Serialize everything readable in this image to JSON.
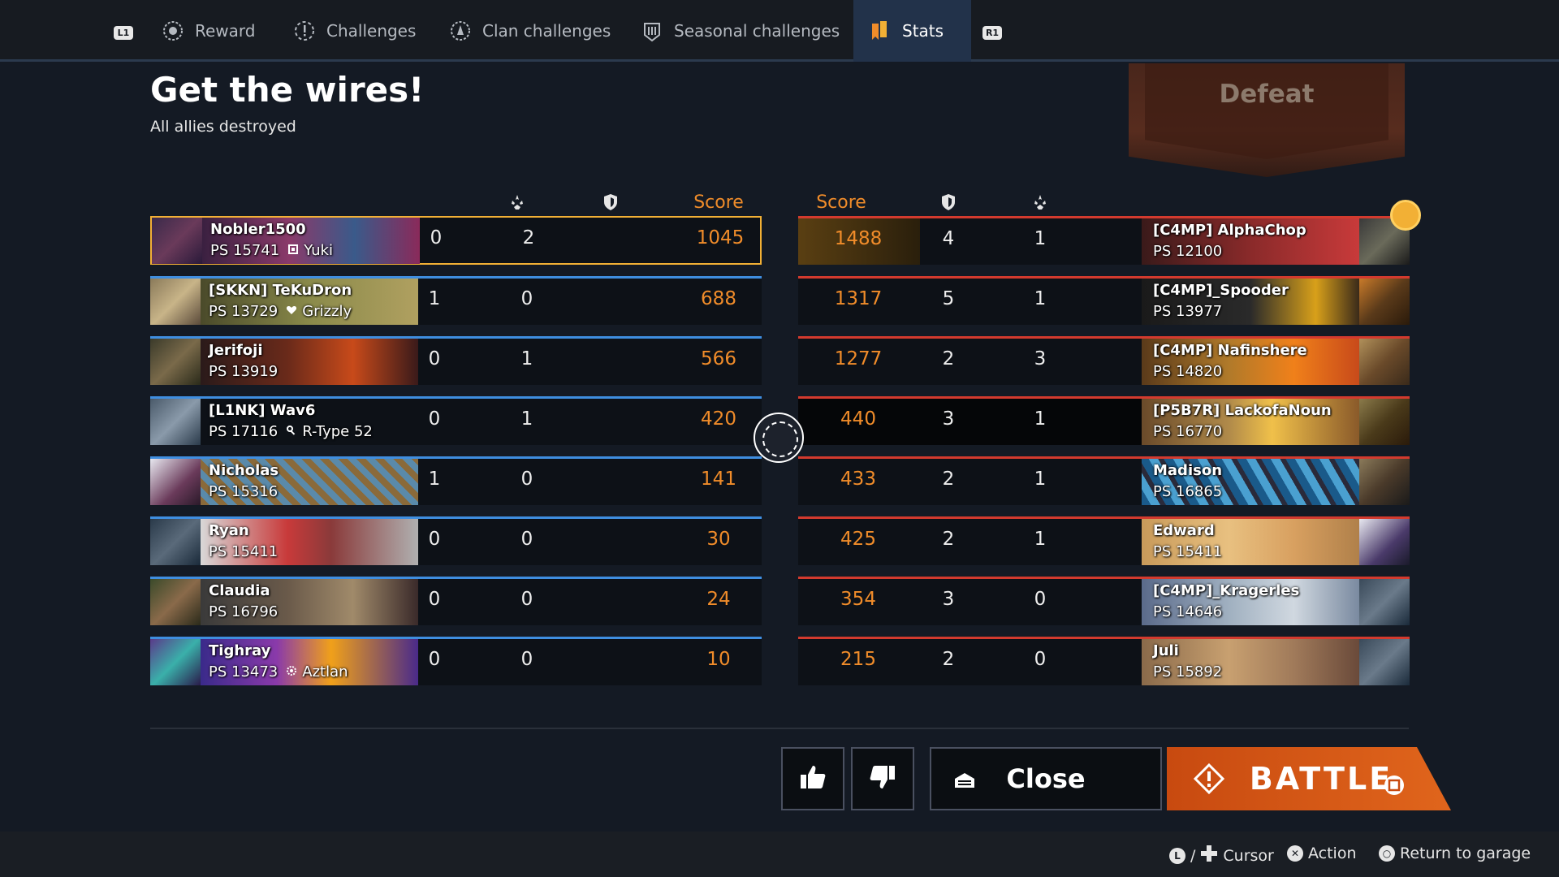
{
  "tabs": {
    "l1": "L1",
    "r1": "R1",
    "items": [
      {
        "label": "Reward",
        "icon": "reward-icon"
      },
      {
        "label": "Challenges",
        "icon": "challenges-icon"
      },
      {
        "label": "Clan challenges",
        "icon": "clan-challenges-icon"
      },
      {
        "label": "Seasonal challenges",
        "icon": "seasonal-challenges-icon"
      },
      {
        "label": "Stats",
        "icon": "stats-icon",
        "active": true
      }
    ]
  },
  "mission": {
    "title": "Get the wires!",
    "subtitle": "All allies destroyed",
    "result": "Defeat"
  },
  "columns": {
    "score": "Score",
    "kills_icon": "kills-icon",
    "damage_icon": "shield-icon"
  },
  "colors": {
    "ally": "#3f8ee0",
    "enemy": "#d33a2e",
    "score": "#f08c2a",
    "self": "#f2b035",
    "battle": "#e0651c"
  },
  "allies": [
    {
      "name": "Nobler1500",
      "ps": "PS 15741",
      "tag": "Yuki",
      "tag_icon": "drone-icon",
      "kills": "0",
      "assists": "2",
      "score": "1045",
      "self": true
    },
    {
      "name": "[SKKN] TeKuDron",
      "ps": "PS 13729",
      "tag": "Grizzly",
      "tag_icon": "heart-icon",
      "kills": "1",
      "assists": "0",
      "score": "688"
    },
    {
      "name": "Jerifoji",
      "ps": "PS 13919",
      "tag": "",
      "kills": "0",
      "assists": "1",
      "score": "566"
    },
    {
      "name": "[L1NK] Wav6",
      "ps": "PS 17116",
      "tag": "R-Type 52",
      "tag_icon": "key-icon",
      "kills": "0",
      "assists": "1",
      "score": "420"
    },
    {
      "name": "Nicholas",
      "ps": "PS 15316",
      "tag": "",
      "kills": "1",
      "assists": "0",
      "score": "141"
    },
    {
      "name": "Ryan",
      "ps": "PS 15411",
      "tag": "",
      "kills": "0",
      "assists": "0",
      "score": "30"
    },
    {
      "name": "Claudia",
      "ps": "PS 16796",
      "tag": "",
      "kills": "0",
      "assists": "0",
      "score": "24"
    },
    {
      "name": "Tighray",
      "ps": "PS 13473",
      "tag": "Aztlan",
      "tag_icon": "gear-icon",
      "kills": "0",
      "assists": "0",
      "score": "10"
    }
  ],
  "enemies": [
    {
      "name": "[C4MP] AlphaChop",
      "ps": "PS 12100",
      "kills": "1",
      "assists": "4",
      "score": "1488"
    },
    {
      "name": "[C4MP]_Spooder",
      "ps": "PS 13977",
      "kills": "1",
      "assists": "5",
      "score": "1317"
    },
    {
      "name": "[C4MP] Nafinshere",
      "ps": "PS 14820",
      "kills": "3",
      "assists": "2",
      "score": "1277"
    },
    {
      "name": "[P5B7R] LackofaNoun",
      "ps": "PS 16770",
      "kills": "1",
      "assists": "3",
      "score": "440"
    },
    {
      "name": "Madison",
      "ps": "PS 16865",
      "kills": "1",
      "assists": "2",
      "score": "433"
    },
    {
      "name": "Edward",
      "ps": "PS 15411",
      "kills": "1",
      "assists": "2",
      "score": "425"
    },
    {
      "name": "[C4MP]_Kragerles",
      "ps": "PS 14646",
      "kills": "0",
      "assists": "3",
      "score": "354"
    },
    {
      "name": "Juli",
      "ps": "PS 15892",
      "kills": "0",
      "assists": "2",
      "score": "215"
    }
  ],
  "buttons": {
    "close": "Close",
    "battle": "BATTLE"
  },
  "hints": {
    "cursor": "Cursor",
    "action": "Action",
    "return": "Return to garage"
  }
}
